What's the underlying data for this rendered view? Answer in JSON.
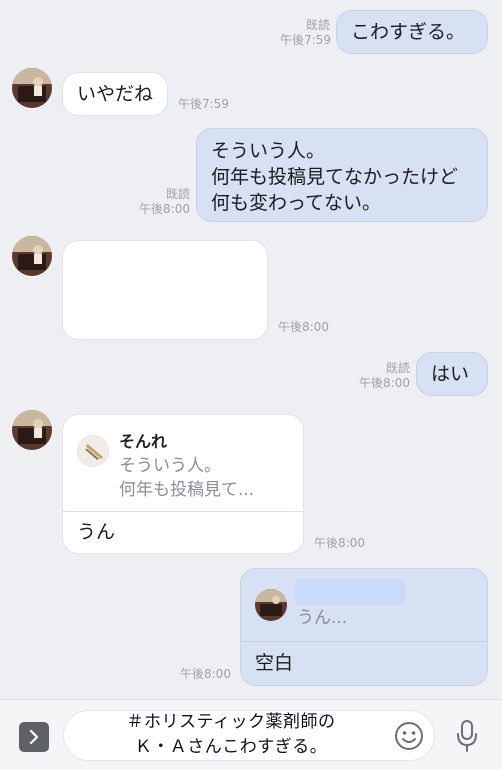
{
  "messages": {
    "m1": {
      "text": "こわすぎる。",
      "read": "既読",
      "time": "午後7:59"
    },
    "m2": {
      "text": "いやだね",
      "time": "午後7:59"
    },
    "m3": {
      "line1": "そういう人。",
      "line2": "何年も投稿見てなかったけど",
      "line3": "何も変わってない。",
      "read": "既読",
      "time": "午後8:00"
    },
    "m4": {
      "time": "午後8:00"
    },
    "m5": {
      "text": "はい",
      "read": "既読",
      "time": "午後8:00"
    },
    "m6": {
      "quote_name": "そんれ",
      "quote_line1": "そういう人。",
      "quote_line2": "何年も投稿見て...",
      "text": "うん",
      "time": "午後8:00"
    },
    "m7": {
      "quote_text": "うん...",
      "text": "空白",
      "time": "午後8:00"
    }
  },
  "input_bar": {
    "caption_line1": "＃ホリスティック薬剤師の",
    "caption_line2": "Ｋ・Ａさんこわすぎる。",
    "icons": [
      "chevron-right-icon",
      "smiley-icon",
      "microphone-icon"
    ]
  },
  "colors": {
    "background": "#edeff3",
    "outgoing_bubble": "#d6e1f3",
    "incoming_bubble": "#ffffff",
    "meta_text": "#9ea2aa"
  }
}
